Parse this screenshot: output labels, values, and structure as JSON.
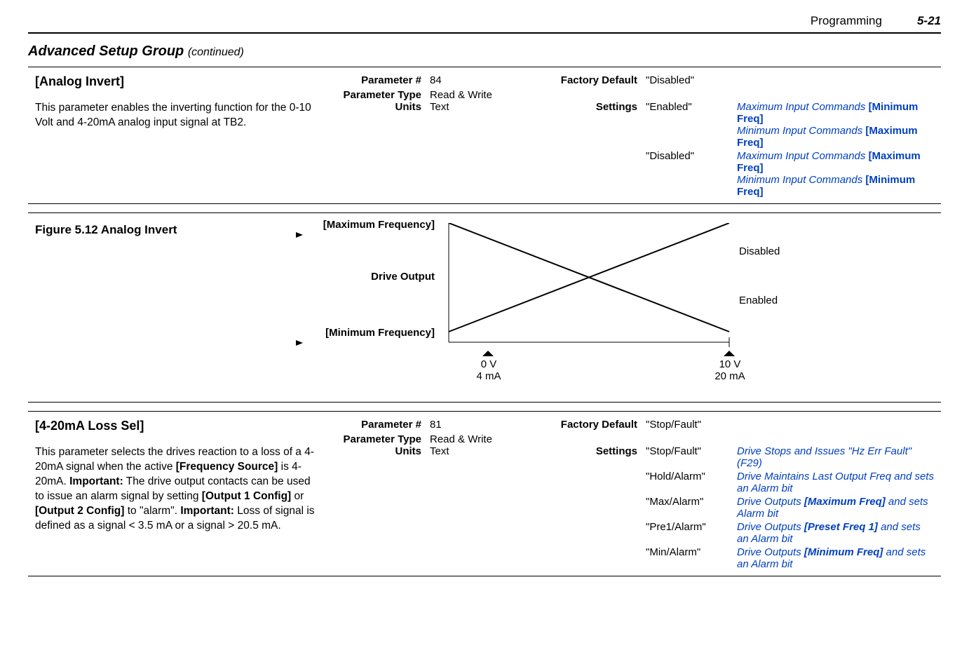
{
  "header": {
    "section": "Programming",
    "pageNum": "5-21"
  },
  "groupTitle": "Advanced Setup Group",
  "groupCont": "(continued)",
  "p84": {
    "name": "[Analog Invert]",
    "row1": {
      "label": "Parameter #",
      "value": "84",
      "fdLabel": "Factory Default",
      "fdValue": "\"Disabled\""
    },
    "row2": {
      "label": "Parameter Type",
      "value": "Read & Write"
    },
    "row3": {
      "label": "Units",
      "value": "Text",
      "fdLabel": "Settings"
    },
    "desc": "This parameter enables the inverting function for the 0-10 Volt and 4-20mA analog input signal at TB2.",
    "settings": [
      {
        "opt": "\"Enabled\"",
        "d1a": "Maximum Input Commands ",
        "d1b": "[Minimum Freq]",
        "d2a": "Minimum Input Commands ",
        "d2b": "[Maximum Freq]"
      },
      {
        "opt": "\"Disabled\"",
        "d1a": "Maximum Input Commands ",
        "d1b": "[Maximum Freq]",
        "d2a": "Minimum Input Commands ",
        "d2b": "[Minimum Freq]"
      }
    ]
  },
  "figure": {
    "title": "Figure 5.12  Analog Invert",
    "maxFreq": "[Maximum Frequency]",
    "minFreq": "[Minimum Frequency]",
    "driveOut": "Drive Output",
    "disabled": "Disabled",
    "enabled": "Enabled",
    "x0a": "0 V",
    "x0b": "4 mA",
    "x1a": "10 V",
    "x1b": "20 mA"
  },
  "p81": {
    "name": "[4-20mA Loss Sel]",
    "row1": {
      "label": "Parameter #",
      "value": "81",
      "fdLabel": "Factory Default",
      "fdValue": "\"Stop/Fault\""
    },
    "row2": {
      "label": "Parameter Type",
      "value": "Read & Write"
    },
    "row3": {
      "label": "Units",
      "value": "Text",
      "fdLabel": "Settings"
    },
    "descParts": {
      "a": "This parameter selects the drives reaction to a loss of a 4-20mA signal when the active ",
      "b": "[Frequency Source]",
      "c": " is 4-20mA. ",
      "d": "Important:",
      "e": " The drive output contacts can be used to issue an alarm signal by setting ",
      "f": "[Output 1 Config]",
      "g": " or ",
      "h": "[Output 2 Config]",
      "i": " to \"alarm\". ",
      "j": "Important:",
      "k": " Loss of signal is defined as a signal < 3.5 mA or a signal > 20.5 mA."
    },
    "settings": [
      {
        "opt": "\"Stop/Fault\"",
        "d": "Drive Stops and Issues \"Hz Err Fault\" (F29)"
      },
      {
        "opt": "\"Hold/Alarm\"",
        "d": "Drive Maintains Last Output Freq and sets an Alarm bit"
      },
      {
        "opt": "\"Max/Alarm\"",
        "dpre": "Drive Outputs ",
        "dbold": "[Maximum Freq]",
        "dpost": " and sets Alarm bit"
      },
      {
        "opt": "\"Pre1/Alarm\"",
        "dpre": "Drive Outputs ",
        "dbold": "[Preset Freq 1]",
        "dpost": " and sets an Alarm bit"
      },
      {
        "opt": "\"Min/Alarm\"",
        "dpre": "Drive Outputs ",
        "dbold": "[Minimum Freq]",
        "dpost": " and sets an Alarm bit"
      }
    ]
  }
}
